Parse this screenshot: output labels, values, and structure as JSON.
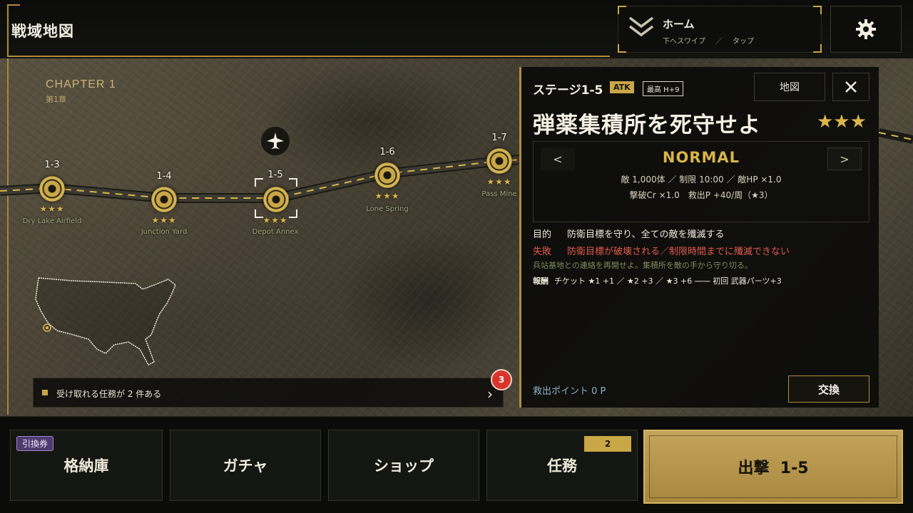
{
  "header": {
    "title": "戦域地図",
    "home_label": "ホーム",
    "home_hint_swipe": "下へスワイプ",
    "home_hint_sep": "／",
    "home_hint_tap": "タップ",
    "settings_icon": "gear-icon"
  },
  "map": {
    "chapter": "CHAPTER 1",
    "chapter_sub": "第1章",
    "nodes": [
      {
        "id": "1-3",
        "stars": "★★★",
        "name": "Dry Lake Airfield"
      },
      {
        "id": "1-4",
        "stars": "★★★",
        "name": "Junction Yard"
      },
      {
        "id": "1-5",
        "stars": "★★★",
        "name": "Depot Annex"
      },
      {
        "id": "1-6",
        "stars": "★★★",
        "name": "Lone Spring"
      },
      {
        "id": "1-7",
        "stars": "★★★",
        "name": "Pass Mine"
      }
    ],
    "selected_node": "1-5"
  },
  "notice": {
    "text": "受け取れる任務が 2 件ある",
    "badge": "3"
  },
  "stage": {
    "number": "ステージ1-5",
    "type_tag": "ATK",
    "best": "最高 H+9",
    "map_button": "地図",
    "title": "弾薬集積所を死守せよ",
    "stars": "★★★",
    "difficulty": "NORMAL",
    "prev": "<",
    "next": ">",
    "stats_line1": "敵 1,000体 ／ 制限 10:00 ／ 敵HP ×1.0",
    "stats_line2": "撃破Cr ×1.0　救出P +40/周（★3）",
    "objective_label": "目的",
    "objective": "防衛目標を守り、全ての敵を殲滅する",
    "fail_label": "失敗",
    "fail": "防衛目標が破壊される／制限時間までに殲滅できない",
    "lore": "兵站基地との連絡を再開せよ。集積所を敵の手から守り切る。",
    "reward_label": "報酬",
    "reward_main": "チケット ★1 +1 ／ ★2 +3 ／ ★3 +6",
    "reward_strike": "——",
    "reward_first": "初回 武器パーツ+3",
    "rescue_points": "救出ポイント 0 P",
    "exchange_button": "交換"
  },
  "bottom_nav": {
    "hangar": "格納庫",
    "hangar_badge": "引換券",
    "gacha": "ガチャ",
    "shop": "ショップ",
    "missions": "任務",
    "missions_count": "2",
    "sortie": "出撃  1-5"
  },
  "colors": {
    "accent_gold": "#c9a646",
    "fail_red": "#e35a4e",
    "badge_red": "#d9342b",
    "voucher_purple": "#4d3a6e"
  }
}
